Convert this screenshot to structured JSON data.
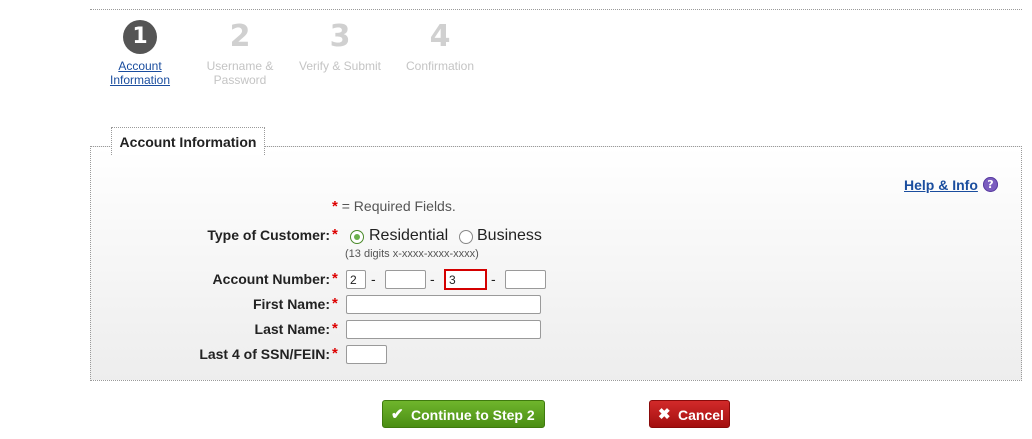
{
  "steps": [
    {
      "num": "1",
      "label": "Account\nInformation",
      "active": true
    },
    {
      "num": "2",
      "label": "Username &\nPassword",
      "active": false
    },
    {
      "num": "3",
      "label": "Verify & Submit",
      "active": false
    },
    {
      "num": "4",
      "label": "Confirmation",
      "active": false
    }
  ],
  "panel": {
    "title": "Account Information"
  },
  "help": {
    "label": "Help & Info",
    "icon": "question-icon",
    "icon_glyph": "?"
  },
  "required_note": {
    "star": "*",
    "text": "= Required Fields."
  },
  "customer_type": {
    "label": "Type of Customer:",
    "options": [
      "Residential",
      "Business"
    ],
    "selected": "Residential",
    "hint": "(13 digits x-xxxx-xxxx-xxxx)"
  },
  "account_number": {
    "label": "Account Number:",
    "parts": [
      "2",
      "",
      "3",
      ""
    ],
    "separator": "-"
  },
  "first_name": {
    "label": "First Name:",
    "value": ""
  },
  "last_name": {
    "label": "Last Name:",
    "value": ""
  },
  "ssn": {
    "label": "Last 4 of SSN/FEIN:",
    "value": ""
  },
  "buttons": {
    "continue": {
      "label": "Continue to Step 2",
      "icon": "check-icon",
      "glyph": "✔"
    },
    "cancel": {
      "label": "Cancel",
      "icon": "x-icon",
      "glyph": "✖"
    }
  },
  "colors": {
    "accent_green": "#5aa01e",
    "cancel_red": "#b81414",
    "link_blue": "#1a4d9e",
    "required_red": "#dd0000"
  }
}
